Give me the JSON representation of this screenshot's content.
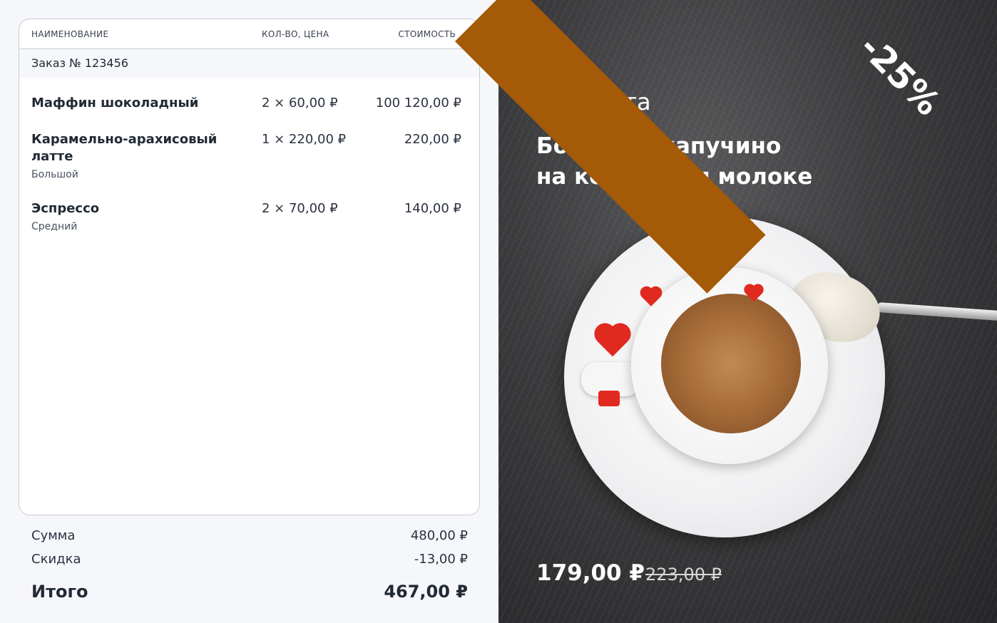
{
  "table": {
    "col_name": "НАИМЕНОВАНИЕ",
    "col_qty": "КОЛ-ВО, ЦЕНА",
    "col_cost": "СТОИМОСТЬ"
  },
  "order": {
    "number_label": "Заказ № 123456"
  },
  "items": [
    {
      "name": "Маффин шоколадный",
      "variant": "",
      "qty_price": "2 × 60,00 ₽",
      "cost": "100 120,00 ₽"
    },
    {
      "name": "Карамельно-арахисовый латте",
      "variant": "Большой",
      "qty_price": "1 × 220,00 ₽",
      "cost": "220,00 ₽"
    },
    {
      "name": "Эспрессо",
      "variant": "Средний",
      "qty_price": "2 × 70,00 ₽",
      "cost": "140,00 ₽"
    }
  ],
  "totals": {
    "sum_label": "Сумма",
    "sum_value": "480,00 ₽",
    "discount_label": "Скидка",
    "discount_value": "-13,00 ₽",
    "total_label": "Итого",
    "total_value": "467,00 ₽"
  },
  "promo": {
    "date": "7 августа",
    "title_line1": "Большой капучино",
    "title_line2": "на кокосовом молоке",
    "price_new": "179,00 ₽",
    "price_old": "223,00 ₽",
    "badge": "-25%",
    "badge_color": "#a45a07"
  }
}
